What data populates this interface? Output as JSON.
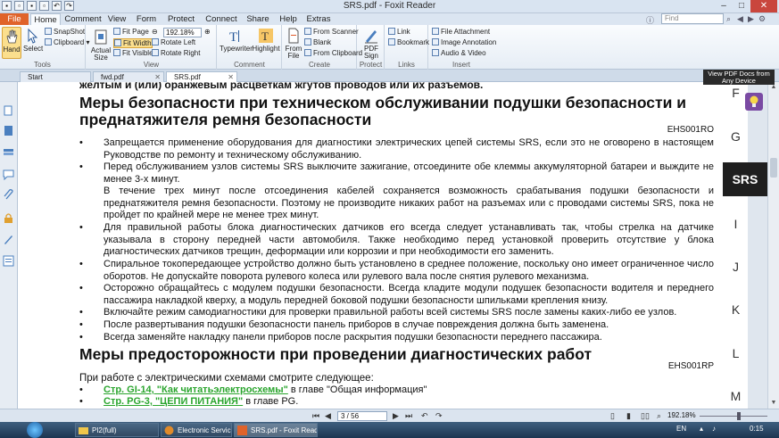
{
  "window": {
    "title": "SRS.pdf - Foxit Reader"
  },
  "ribbon_tabs": [
    "File",
    "Home",
    "Comment",
    "View",
    "Form",
    "Protect",
    "Connect",
    "Share",
    "Help",
    "Extras"
  ],
  "find": {
    "placeholder": "Find"
  },
  "ribbon": {
    "tools": {
      "hand": "Hand",
      "select": "Select",
      "snapshot": "SnapShot",
      "clipboard": "Clipboard",
      "label": "Tools"
    },
    "view": {
      "actual_size": "Actual Size",
      "fit_page": "Fit Page",
      "fit_width": "Fit Width",
      "fit_visible": "Fit Visible",
      "zoom": "192.18%",
      "rotate_left": "Rotate Left",
      "rotate_right": "Rotate Right",
      "label": "View"
    },
    "comment": {
      "typewriter": "Typewriter",
      "highlight": "Highlight",
      "label": "Comment"
    },
    "create": {
      "from_file": "From File",
      "from_scanner": "From Scanner",
      "blank": "Blank",
      "from_clipboard": "From Clipboard",
      "label": "Create"
    },
    "protect": {
      "pdf_sign": "PDF Sign",
      "label": "Protect"
    },
    "links": {
      "link": "Link",
      "bookmark": "Bookmark",
      "label": "Links"
    },
    "insert": {
      "file_attachment": "File Attachment",
      "image_annotation": "Image Annotation",
      "audio_video": "Audio & Video",
      "label": "Insert"
    }
  },
  "doc_tabs": [
    "Start",
    "fwd.pdf",
    "SRS.pdf"
  ],
  "tooltip": "View PDF Docs from Any Device",
  "document": {
    "cut_line": "желтым и (или) оранжевым расцветкам жгутов проводов или их разъемов.",
    "section1": {
      "title_line1": "Меры безопасности при техническом обслуживании подушки безопасности и",
      "title_line2": "преднатяжителя ремня безопасности",
      "code": "EHS001RO",
      "bullets": [
        "Запрещается применение оборудования для диагностики электрических цепей системы SRS, если это не оговорено в настоящем Руководстве по ремонту и техническому обслуживанию.",
        "Перед обслуживанием узлов системы SRS выключите зажигание, отсоедините обе клеммы аккумуляторной батареи и выждите не менее 3-х минут.",
        "В течение трех минут после отсоединения кабелей сохраняется возможность срабатывания подушки безопасности и преднатяжителя ремня безопасности. Поэтому не производите никаких работ на разъемах или с проводами системы SRS, пока не пройдет по крайней мере не менее трех минут.",
        "Для правильной работы блока диагностических датчиков его всегда следует устанавливать так, чтобы стрелка на датчике указывала в сторону передней части автомобиля. Также необходимо перед установкой проверить отсутствие у блока диагностических датчиков трещин, деформации или коррозии и при необходимости его заменить.",
        "Спиральное токопередающее устройство должно быть установлено в среднее положение, поскольку оно имеет ограниченное число оборотов. Не допускайте поворота рулевого колеса или рулевого вала после снятия рулевого механизма.",
        "Осторожно обращайтесь с модулем подушки безопасности. Всегда кладите модули подушек безопасности водителя и переднего пассажира накладкой кверху, а модуль передней боковой подушки безопасности шпильками крепления книзу.",
        "Включайте режим самодиагностики для проверки правильной работы всей системы SRS после замены каких-либо ее узлов.",
        "После развертывания подушки безопасности панель приборов в случае повреждения должна быть заменена.",
        "Всегда заменяйте накладку панели приборов после раскрытия подушки безопасности переднего пассажира."
      ]
    },
    "section2": {
      "title": "Меры предосторожности при проведении диагностических работ",
      "code": "EHS001RP",
      "intro": "При работе с электрическими схемами смотрите следующее:",
      "links": [
        {
          "link": "Стр. GI-14, \"Как читатьэлектросхемы\"",
          "rest": " в главе \"Общая информация\""
        },
        {
          "link": "Стр. PG-3, \"ЦЕПИ ПИТАНИЯ\"",
          "rest": " в главе PG."
        }
      ]
    }
  },
  "index_tabs": [
    "F",
    "G",
    "SRS",
    "I",
    "J",
    "K",
    "L",
    "M"
  ],
  "status": {
    "page": "3 / 56",
    "zoom": "192.18%"
  },
  "taskbar": {
    "items": [
      "PI2(full)",
      "Electronic Service M...",
      "SRS.pdf - Foxit Reader"
    ],
    "lang": "EN",
    "time": "0:15"
  },
  "colors": {
    "file_tab": "#e0632a",
    "link_green": "#2aa52e",
    "srs_tab": "#1f1f1f",
    "accent": "#4a7fbf"
  }
}
